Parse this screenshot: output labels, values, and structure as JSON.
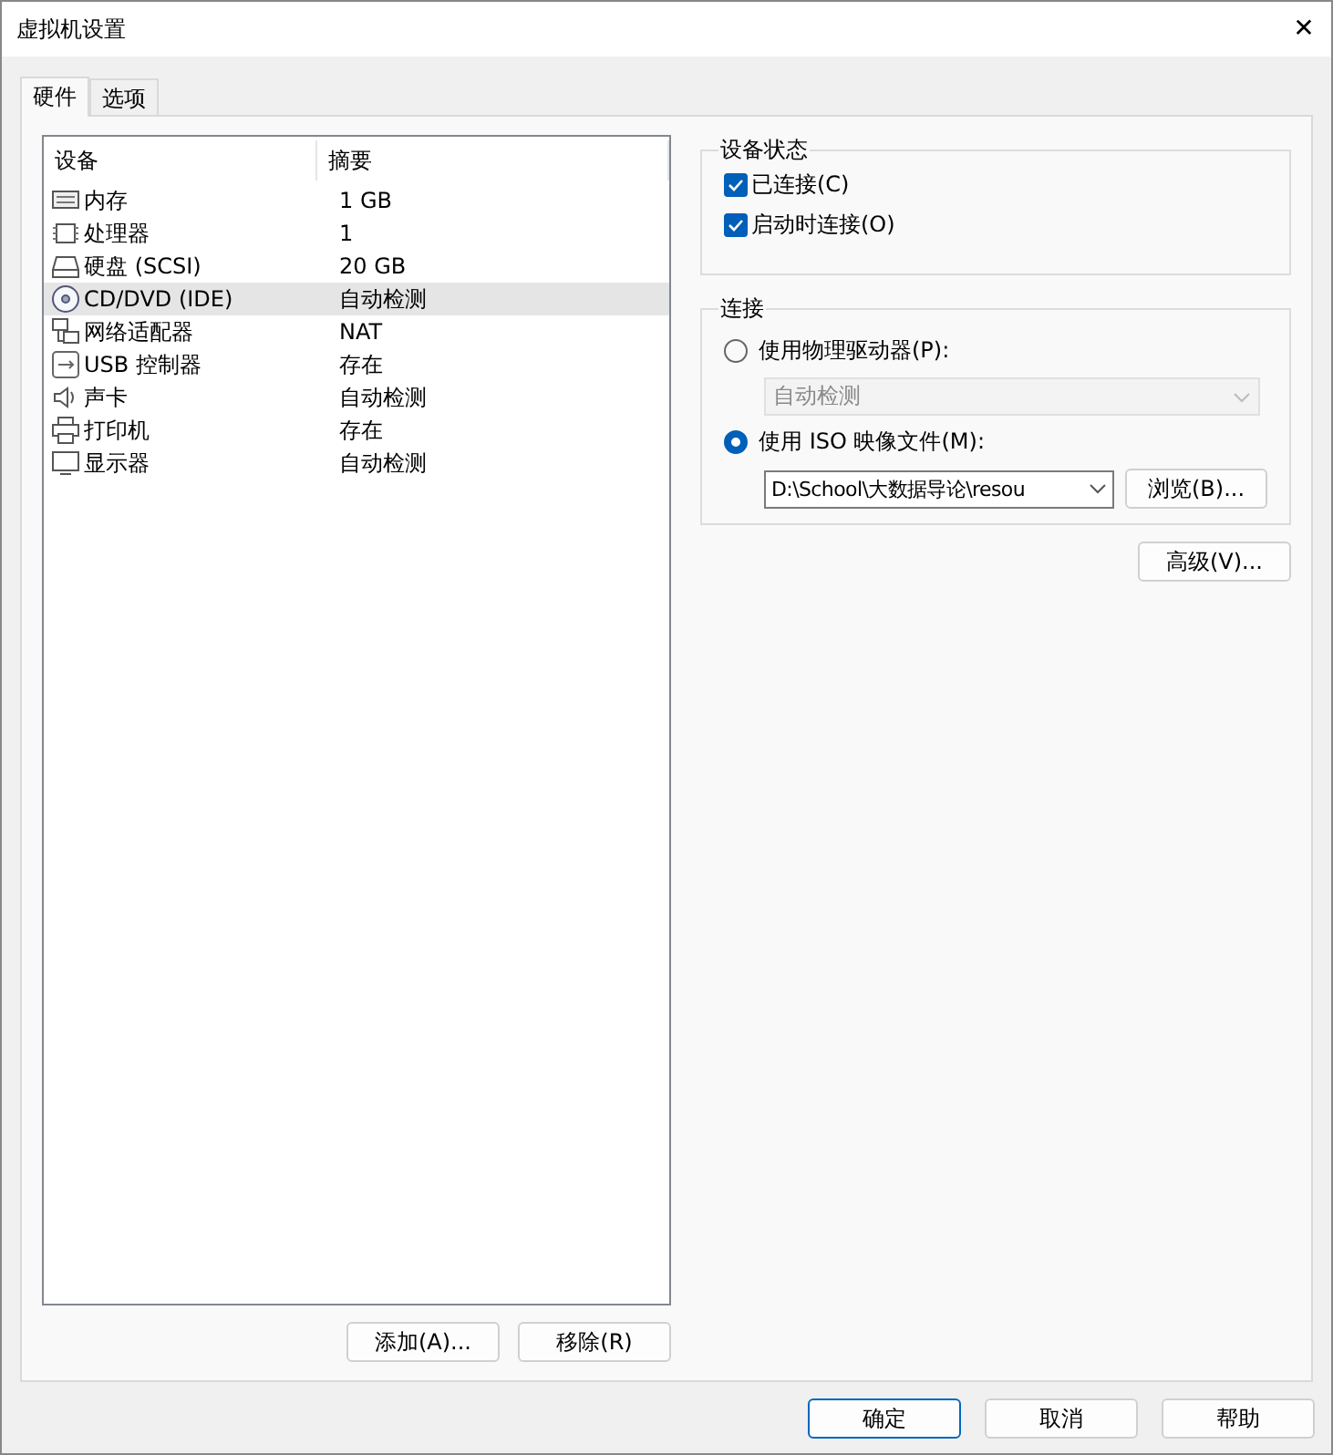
{
  "window": {
    "title": "虚拟机设置",
    "close": "✕"
  },
  "tabs": [
    {
      "label": "硬件",
      "selected": true
    },
    {
      "label": "选项",
      "selected": false
    }
  ],
  "device_list": {
    "columns": [
      "设备",
      "摘要"
    ],
    "rows": [
      {
        "kind": "memory",
        "device": "内存",
        "summary": "1 GB",
        "selected": false
      },
      {
        "kind": "cpu",
        "device": "处理器",
        "summary": "1",
        "selected": false
      },
      {
        "kind": "disk",
        "device": "硬盘 (SCSI)",
        "summary": "20 GB",
        "selected": false
      },
      {
        "kind": "cd",
        "device": "CD/DVD (IDE)",
        "summary": "自动检测",
        "selected": true
      },
      {
        "kind": "network",
        "device": "网络适配器",
        "summary": "NAT",
        "selected": false
      },
      {
        "kind": "usb",
        "device": "USB 控制器",
        "summary": "存在",
        "selected": false
      },
      {
        "kind": "sound",
        "device": "声卡",
        "summary": "自动检测",
        "selected": false
      },
      {
        "kind": "printer",
        "device": "打印机",
        "summary": "存在",
        "selected": false
      },
      {
        "kind": "display",
        "device": "显示器",
        "summary": "自动检测",
        "selected": false
      }
    ]
  },
  "list_buttons": [
    "添加(A)...",
    "移除(R)"
  ],
  "device_status": {
    "title": "设备状态",
    "options": [
      {
        "label": "已连接(C)",
        "checked": true
      },
      {
        "label": "启动时连接(O)",
        "checked": true
      }
    ]
  },
  "connection": {
    "title": "连接",
    "physical": {
      "label": "使用物理驱动器(P):",
      "selected": false,
      "dropdown": {
        "value": "自动检测",
        "disabled": true
      }
    },
    "iso": {
      "label": "使用 ISO 映像文件(M):",
      "selected": true,
      "dropdown": {
        "value": "D:\\School\\大数据导论\\resou",
        "disabled": false
      },
      "browse": "浏览(B)..."
    }
  },
  "advanced_button": "高级(V)...",
  "buttons": [
    {
      "label": "确定",
      "default": true
    },
    {
      "label": "取消",
      "default": false
    },
    {
      "label": "帮助",
      "default": false
    }
  ]
}
